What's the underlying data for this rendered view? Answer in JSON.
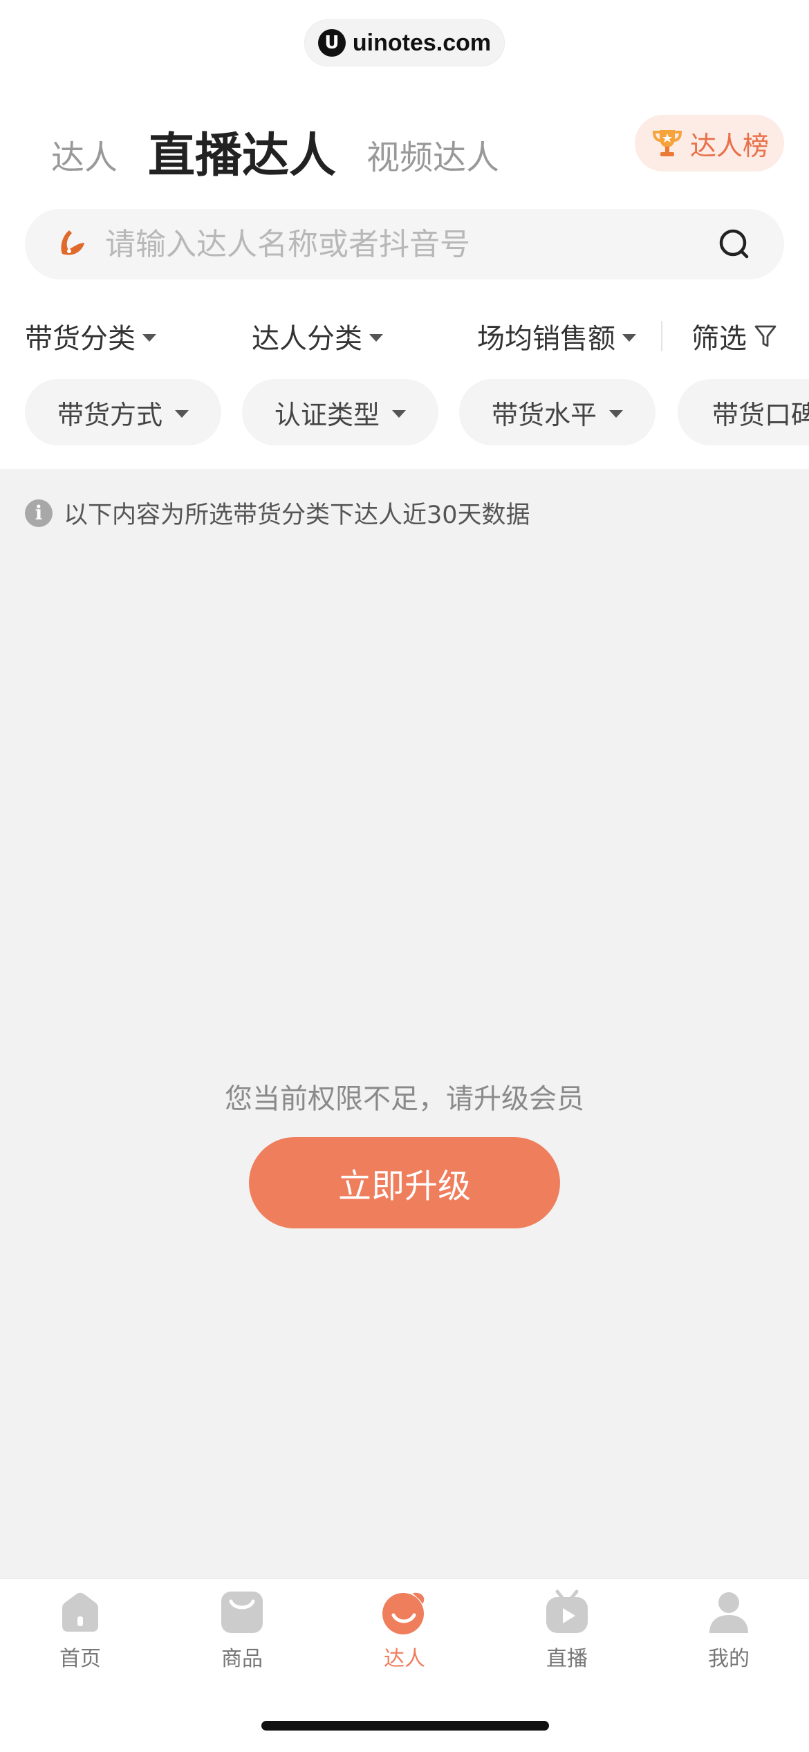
{
  "watermark": {
    "logo": "U",
    "text": "uinotes.com"
  },
  "tabs": [
    {
      "label": "达人",
      "active": false
    },
    {
      "label": "直播达人",
      "active": true
    },
    {
      "label": "视频达人",
      "active": false
    }
  ],
  "rank_button": {
    "label": "达人榜",
    "icon": "trophy-icon"
  },
  "search": {
    "placeholder": "请输入达人名称或者抖音号",
    "value": ""
  },
  "filters": [
    {
      "label": "带货分类"
    },
    {
      "label": "达人分类"
    },
    {
      "label": "场均销售额"
    },
    {
      "label": "筛选"
    }
  ],
  "chips": [
    {
      "label": "带货方式"
    },
    {
      "label": "认证类型"
    },
    {
      "label": "带货水平"
    },
    {
      "label": "带货口碑"
    }
  ],
  "info": {
    "text": "以下内容为所选带货分类下达人近30天数据"
  },
  "empty_state": {
    "message": "您当前权限不足，请升级会员",
    "button_label": "立即升级"
  },
  "bottom_nav": [
    {
      "label": "首页",
      "icon": "home-icon",
      "active": false
    },
    {
      "label": "商品",
      "icon": "bag-icon",
      "active": false
    },
    {
      "label": "达人",
      "icon": "creator-icon",
      "active": true
    },
    {
      "label": "直播",
      "icon": "tv-play-icon",
      "active": false
    },
    {
      "label": "我的",
      "icon": "user-icon",
      "active": false
    }
  ],
  "colors": {
    "accent": "#ef7e5d",
    "accent_text": "#e8704a",
    "rank_bg": "#fdece5",
    "page_bg": "#f2f2f2",
    "nav_inactive": "#c8c8c8"
  }
}
